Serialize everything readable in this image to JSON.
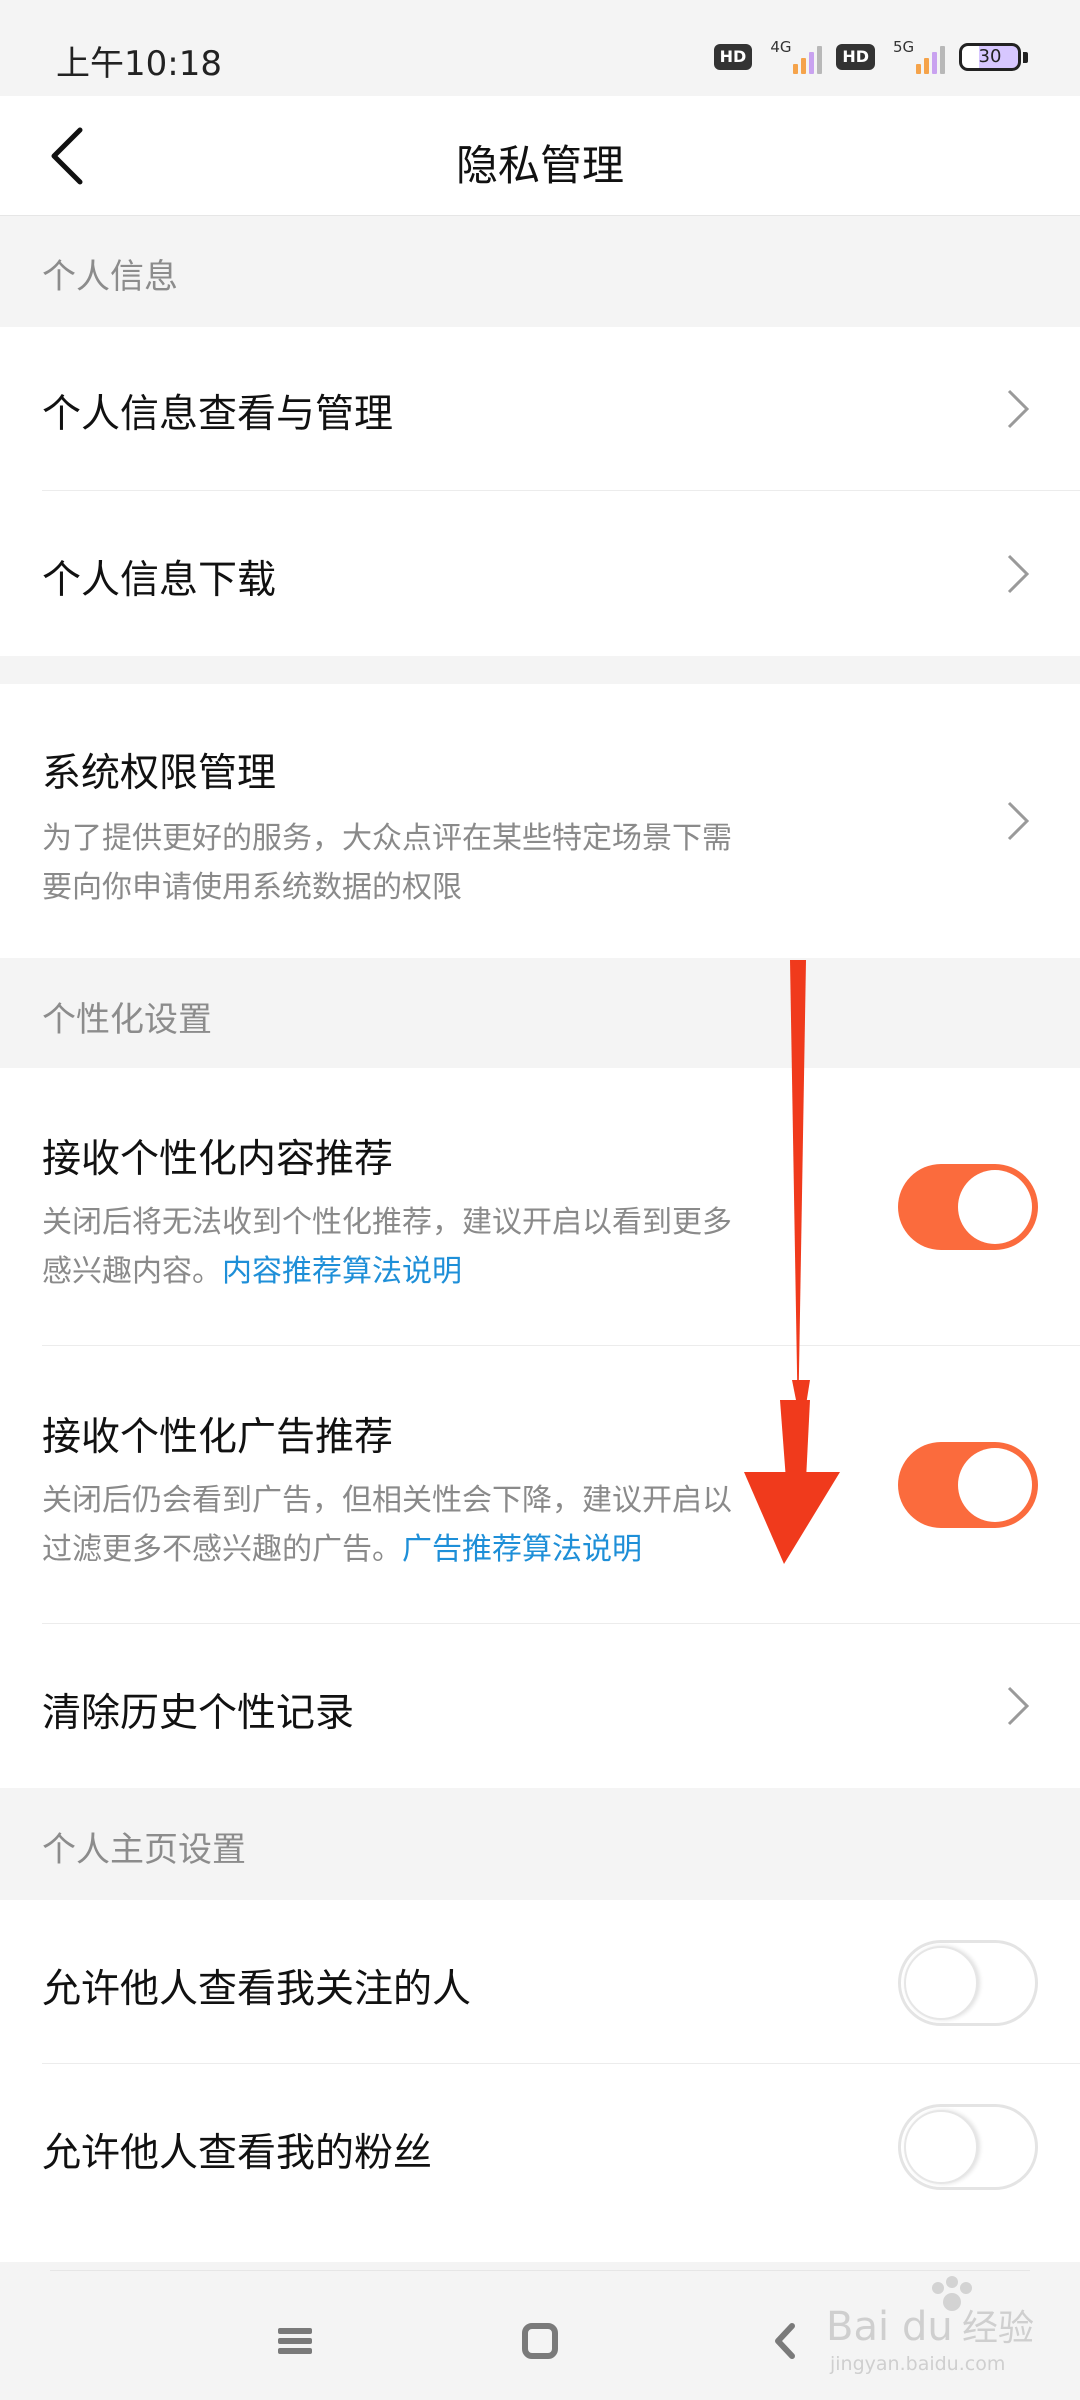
{
  "status_bar": {
    "time": "上午10:18",
    "hd_label_1": "HD",
    "network_1": "4G",
    "hd_label_2": "HD",
    "network_2": "5G",
    "battery": "30"
  },
  "header": {
    "title": "隐私管理",
    "back_icon": "chevron-left-icon"
  },
  "sections": {
    "personal_info": {
      "header": "个人信息",
      "items": [
        {
          "title": "个人信息查看与管理",
          "icon": "chevron-right-icon"
        },
        {
          "title": "个人信息下载",
          "icon": "chevron-right-icon"
        }
      ]
    },
    "system": {
      "title": "系统权限管理",
      "desc_line1": "为了提供更好的服务，大众点评在某些特定场景下需",
      "desc_line2": "要向你申请使用系统数据的权限",
      "icon": "chevron-right-icon"
    },
    "personalization": {
      "header": "个性化设置",
      "content_rec": {
        "title": "接收个性化内容推荐",
        "desc_line1": "关闭后将无法收到个性化推荐，建议开启以看到更多",
        "desc_line2": "感兴趣内容。",
        "link": "内容推荐算法说明",
        "enabled": true
      },
      "ad_rec": {
        "title": "接收个性化广告推荐",
        "desc_line1": "关闭后仍会看到广告，但相关性会下降，建议开启以",
        "desc_line2": "过滤更多不感兴趣的广告。",
        "link": "广告推荐算法说明",
        "enabled": true
      },
      "clear_history": {
        "title": "清除历史个性记录",
        "icon": "chevron-right-icon"
      }
    },
    "profile": {
      "header": "个人主页设置",
      "following": {
        "title": "允许他人查看我关注的人",
        "enabled": false
      },
      "fans": {
        "title": "允许他人查看我的粉丝",
        "enabled": false
      }
    }
  },
  "nav_bar": {
    "menu_icon": "menu-icon",
    "home_icon": "home-icon",
    "back_icon": "back-triangle-icon"
  },
  "watermark": {
    "brand": "Bai",
    "brand_suffix": "du",
    "cn": "经验",
    "url": "jingyan.baidu.com"
  },
  "colors": {
    "accent_orange": "#fb6b3d",
    "link_blue": "#1e8fd8",
    "annotation_red": "#f03a1c"
  }
}
